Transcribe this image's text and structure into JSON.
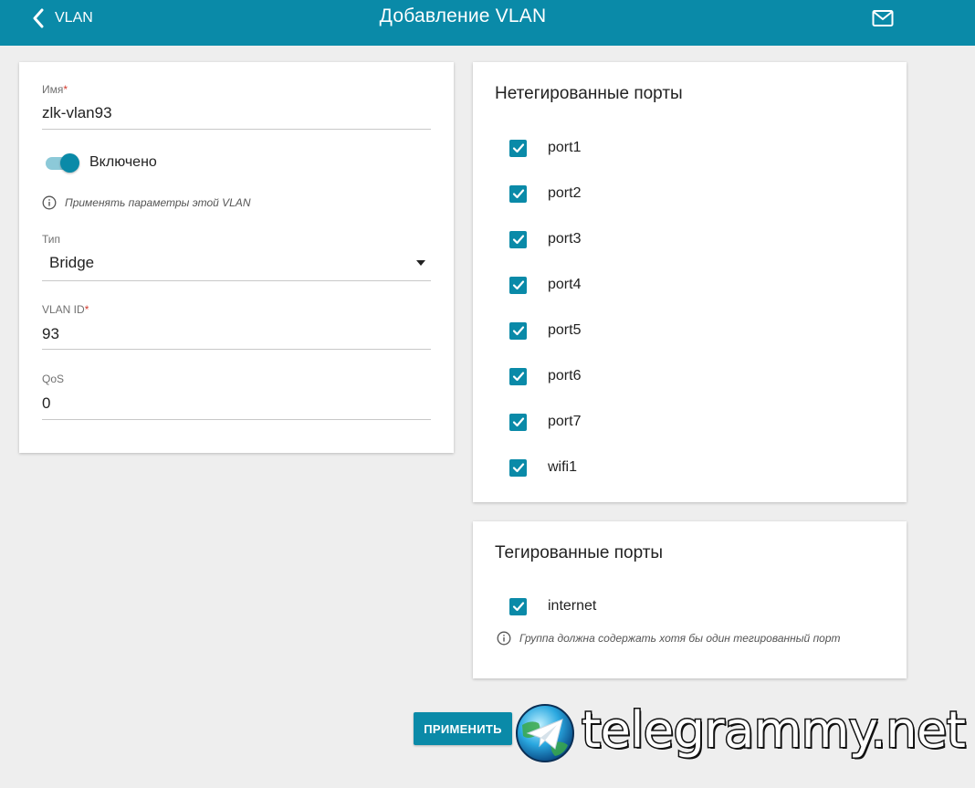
{
  "header": {
    "back_label": "VLAN",
    "title": "Добавление VLAN",
    "mail_icon": "mail-icon"
  },
  "form": {
    "name": {
      "label": "Имя",
      "required_mark": "*",
      "value": "zlk-vlan93"
    },
    "enabled": {
      "label": "Включено",
      "on": true
    },
    "enabled_hint": "Применять параметры этой VLAN",
    "type": {
      "label": "Тип",
      "value": "Bridge"
    },
    "vlan_id": {
      "label": "VLAN ID",
      "required_mark": "*",
      "value": "93"
    },
    "qos": {
      "label": "QoS",
      "value": "0"
    }
  },
  "untagged": {
    "title": "Нетегированные порты",
    "ports": [
      {
        "label": "port1",
        "checked": true
      },
      {
        "label": "port2",
        "checked": true
      },
      {
        "label": "port3",
        "checked": true
      },
      {
        "label": "port4",
        "checked": true
      },
      {
        "label": "port5",
        "checked": true
      },
      {
        "label": "port6",
        "checked": true
      },
      {
        "label": "port7",
        "checked": true
      },
      {
        "label": "wifi1",
        "checked": true
      }
    ]
  },
  "tagged": {
    "title": "Тегированные порты",
    "ports": [
      {
        "label": "internet",
        "checked": true
      }
    ],
    "hint": "Группа должна содержать хотя бы один тегированный порт"
  },
  "actions": {
    "apply_label": "ПРИМЕНИТЬ"
  },
  "watermark": {
    "text": "telegrammy.net"
  },
  "colors": {
    "accent": "#0a8aa8",
    "background": "#eeeeee",
    "required": "#d23a2e"
  }
}
